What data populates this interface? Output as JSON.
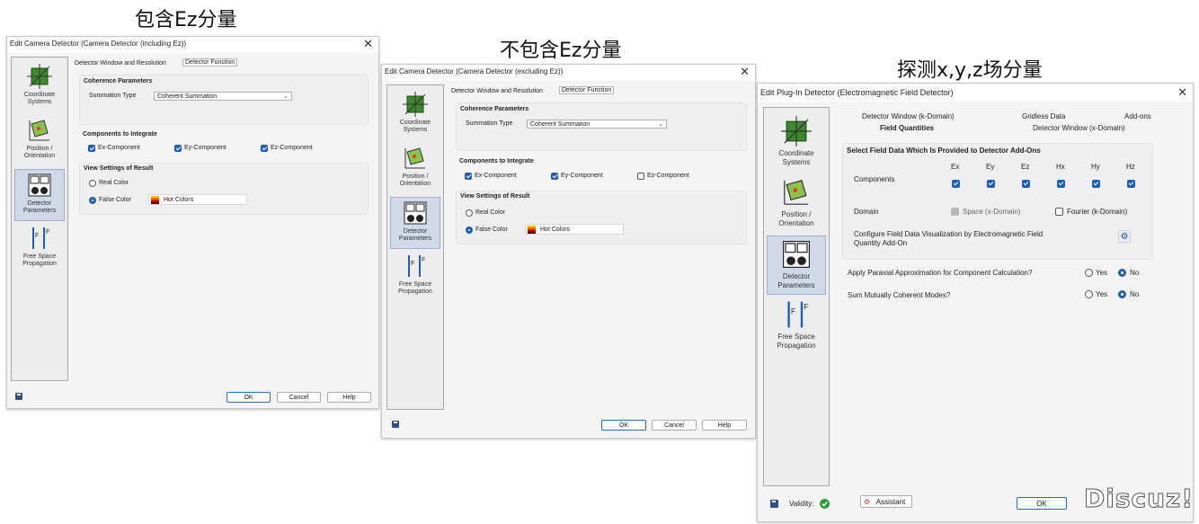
{
  "captions": {
    "c1": "包含Ez分量",
    "c2": "不包含Ez分量",
    "c3": "探测x,y,z场分量"
  },
  "icons": [
    "coordinate-systems-icon",
    "position-orientation-icon",
    "detector-parameters-icon",
    "free-space-propagation-icon",
    "save-icon",
    "close-icon",
    "gear-icon",
    "check-icon"
  ],
  "sidebar": {
    "coordinate_systems": "Coordinate Systems",
    "position_orientation": "Position / Orientation",
    "detector_parameters": "Detector Parameters",
    "free_space_propagation": "Free Space Propagation"
  },
  "dialog1": {
    "title": "Edit Camera Detector (Camera Detector (including Ez))",
    "tab_window": "Detector Window and Resolution",
    "tab_function": "Detector Function",
    "coherence_title": "Coherence Parameters",
    "summation_label": "Summation Type",
    "summation_value": "Coherent Summation",
    "components_title": "Components to Integrate",
    "ex": "Ex-Component",
    "ey": "Ey-Component",
    "ez": "Ez-Component",
    "view_title": "View Settings of Result",
    "real_color": "Real Color",
    "false_color": "False Color",
    "hot_colors": "Hot Colors",
    "ok": "OK",
    "cancel": "Cancel",
    "help": "Help"
  },
  "dialog2": {
    "title": "Edit Camera Detector (Camera Detector (excluding Ez))",
    "tab_window": "Detector Window and Resolution",
    "tab_function": "Detector Function",
    "coherence_title": "Coherence Parameters",
    "summation_label": "Summation Type",
    "summation_value": "Coherent Summation",
    "components_title": "Components to Integrate",
    "ex": "Ex-Component",
    "ey": "Ey-Component",
    "ez": "Ez-Component",
    "view_title": "View Settings of Result",
    "real_color": "Real Color",
    "false_color": "False Color",
    "hot_colors": "Hot Colors",
    "ok": "OK",
    "cancel": "Cancel",
    "help": "Help"
  },
  "dialog3": {
    "title": "Edit Plug-In Detector (Electromagnetic Field Detector)",
    "tab_window_k": "Detector Window (k-Domain)",
    "tab_gridless": "Gridless Data",
    "tab_addons": "Add-ons",
    "tab_field_quantities": "Field Quantities",
    "tab_window_x": "Detector Window (x-Domain)",
    "select_title": "Select Field Data Which Is Provided to Detector Add-Ons",
    "components_label": "Components",
    "comp_ex": "Ex",
    "comp_ey": "Ey",
    "comp_ez": "Ez",
    "comp_hx": "Hx",
    "comp_hy": "Hy",
    "comp_hz": "Hz",
    "domain_label": "Domain",
    "space": "Space (x-Domain)",
    "fourier": "Fourier (k-Domain)",
    "configure_line1": "Configure Field Data Visualization by Electromagnetic Field",
    "configure_line2": "Quantity Add-On",
    "paraxial": "Apply Paraxial Approximation for Component Calculation?",
    "sum_modes": "Sum Mutually Coherent Modes?",
    "yes": "Yes",
    "no": "No",
    "validity": "Validity:",
    "assistant": "Assistant",
    "ok": "OK"
  },
  "watermark": "Discuz!",
  "colors": {
    "accent": "#1e5fb4",
    "selected_side": "#cfd9e8",
    "dialog_bg": "#f4f4f4"
  }
}
